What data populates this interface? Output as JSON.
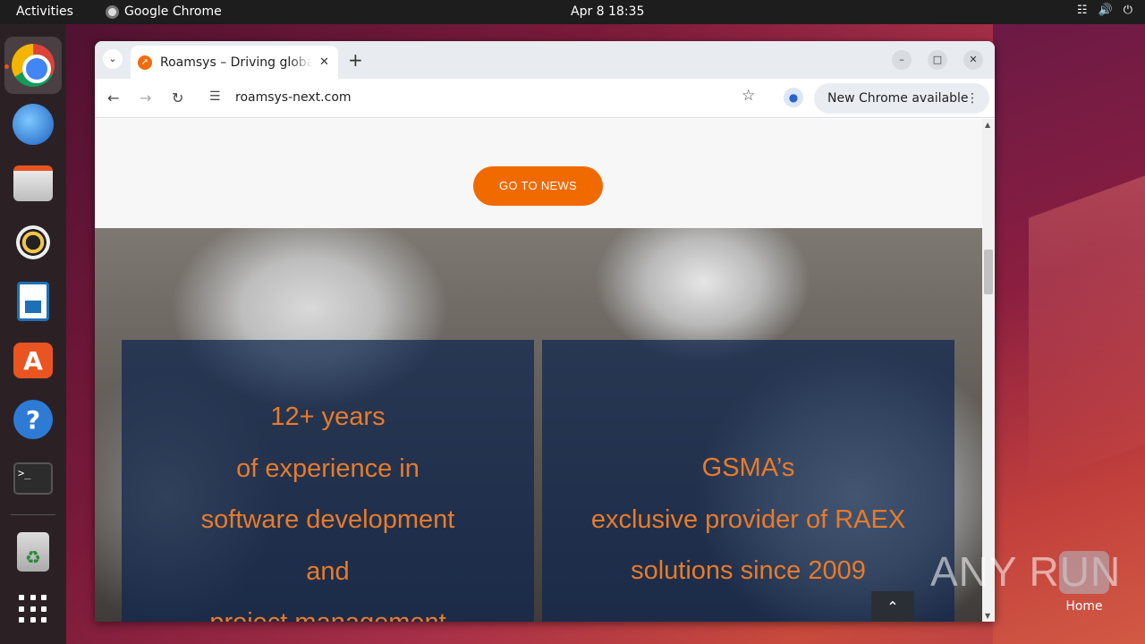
{
  "topbar": {
    "activities": "Activities",
    "app_name": "Google Chrome",
    "clock": "Apr 8  18:35",
    "tray_icons": [
      "network-icon",
      "volume-icon",
      "power-icon"
    ]
  },
  "dock": {
    "items": [
      "chrome",
      "thunderbird",
      "files",
      "rhythmbox",
      "writer",
      "app-center",
      "help",
      "terminal",
      "trash",
      "show-apps"
    ],
    "terminal_glyph": ">_"
  },
  "browser": {
    "tab_title": "Roamsys – Driving global",
    "url": "roamsys-next.com",
    "update_label": "New Chrome available",
    "accent": "#f26b0c"
  },
  "page": {
    "news_button": "GO TO NEWS",
    "card_left": {
      "lines": [
        "12+ years",
        "of experience in",
        "software development",
        "and",
        "project management"
      ]
    },
    "card_right": {
      "lines": [
        "GSMA’s",
        "exclusive provider of RAEX",
        "solutions since 2009"
      ]
    },
    "text_color": "#e87b2a",
    "card_color": "#0e264e"
  },
  "desktop": {
    "watermark": "ANY RUN",
    "home_label": "Home"
  }
}
